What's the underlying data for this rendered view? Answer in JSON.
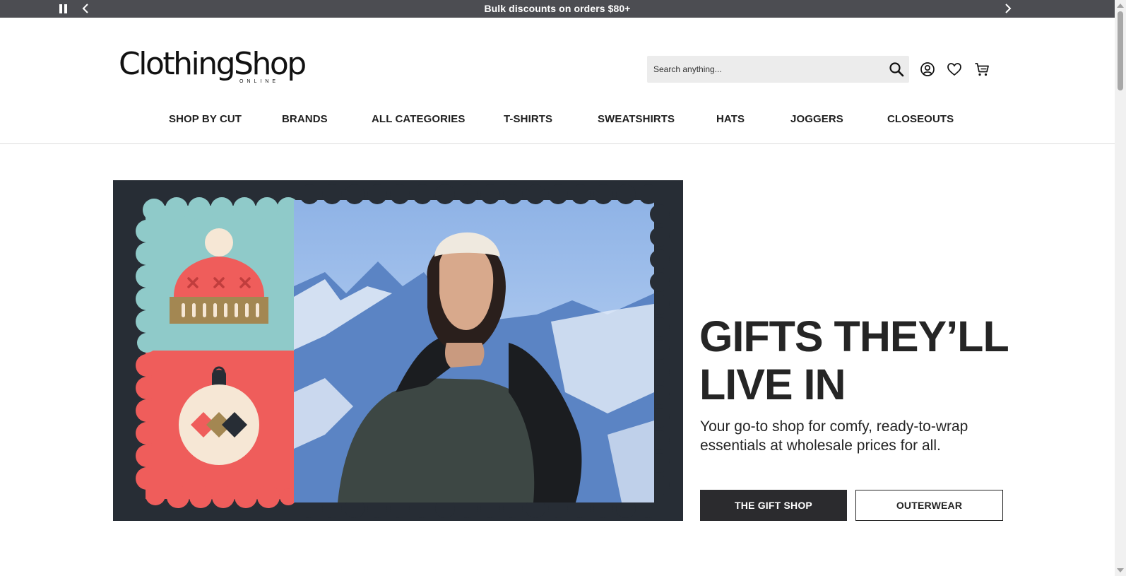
{
  "announcement": {
    "message": "Bulk discounts on orders $80+"
  },
  "header": {
    "logo_text": "ClothingShop",
    "logo_subtext": "ONLINE",
    "search_placeholder": "Search anything..."
  },
  "icons": {
    "pause": "pause-icon",
    "prev": "chevron-left-icon",
    "next": "chevron-right-icon",
    "search": "search-icon",
    "account": "user-icon",
    "wishlist": "heart-icon",
    "cart": "cart-icon"
  },
  "nav": {
    "items": [
      {
        "label": "SHOP BY CUT"
      },
      {
        "label": "BRANDS"
      },
      {
        "label": "ALL CATEGORIES"
      },
      {
        "label": "T-SHIRTS"
      },
      {
        "label": "SWEATSHIRTS"
      },
      {
        "label": "HATS"
      },
      {
        "label": "JOGGERS"
      },
      {
        "label": "CLOSEOUTS"
      }
    ]
  },
  "hero": {
    "headline_line1": "GIFTS THEY’LL",
    "headline_line2": "LIVE IN",
    "subcopy": "Your go-to shop for comfy, ready-to-wrap essentials at wholesale prices for all.",
    "primary_button": "THE GIFT SHOP",
    "secondary_button": "OUTERWEAR"
  },
  "colors": {
    "announcement_bg": "#4c4d52",
    "hero_bg": "#272d35",
    "teal": "#8fcac9",
    "coral": "#ef5d5b",
    "primary_button_bg": "#2b2b2e"
  }
}
